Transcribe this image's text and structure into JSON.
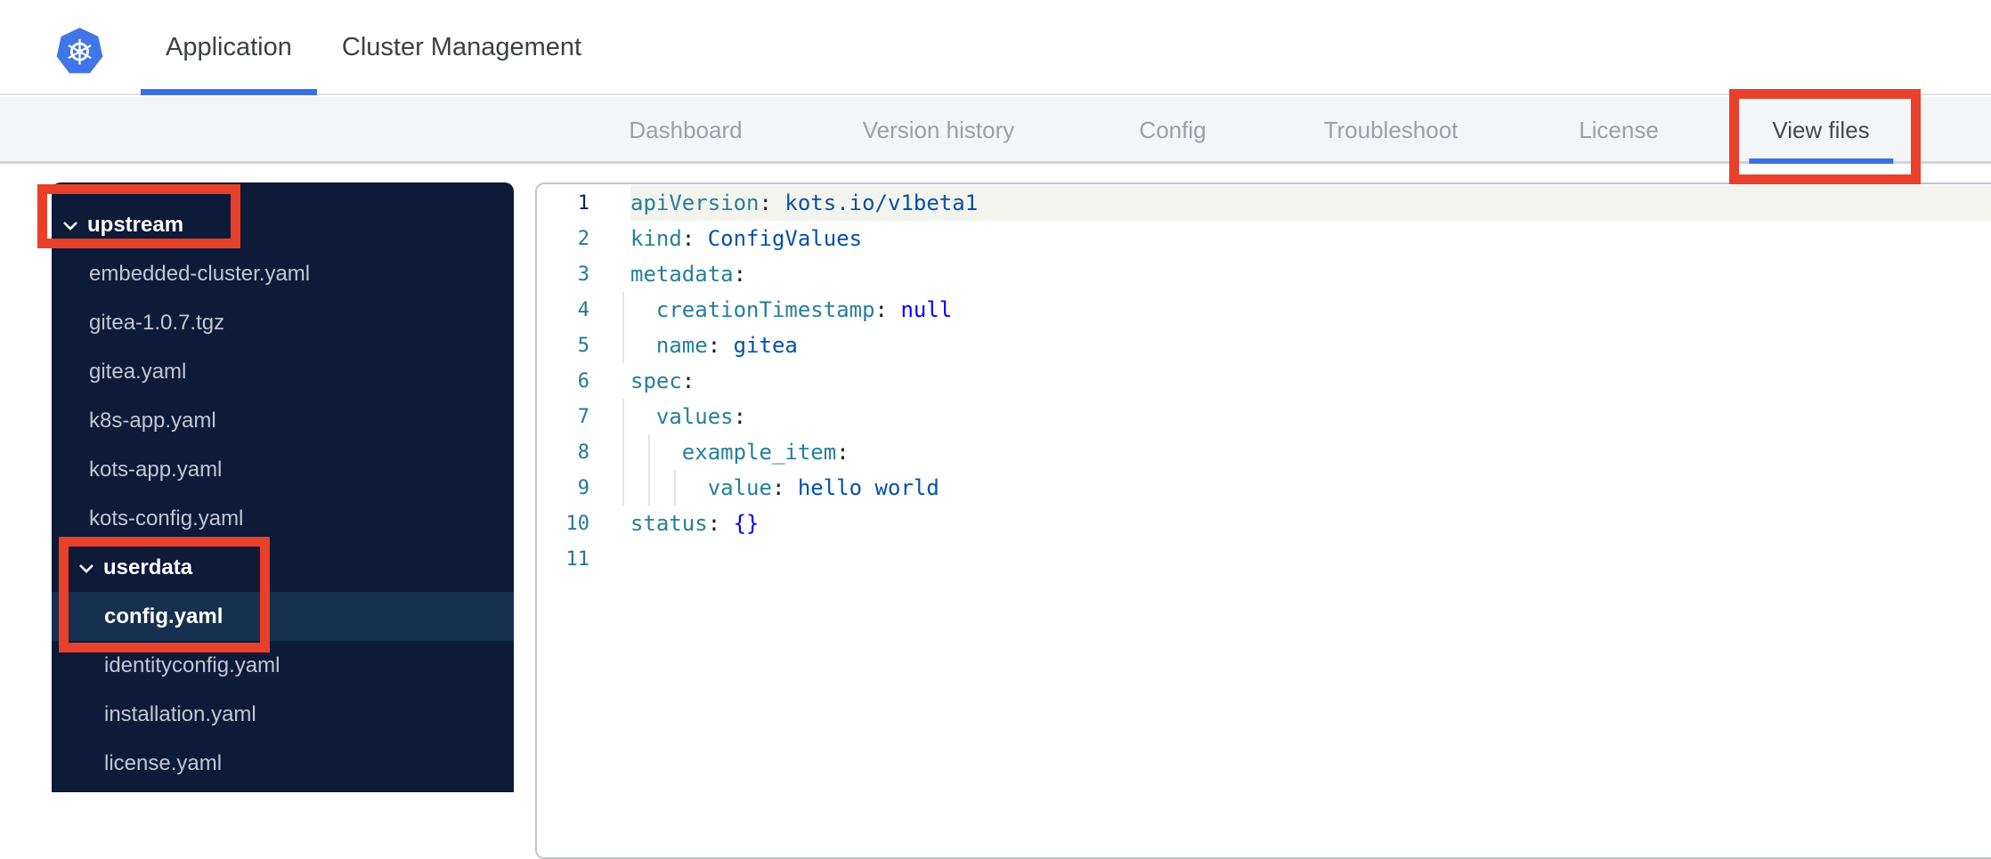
{
  "topbar": {
    "logo": "kubernetes-logo",
    "tabs": [
      {
        "label": "Application",
        "active": true
      },
      {
        "label": "Cluster Management",
        "active": false
      }
    ]
  },
  "subnav": {
    "items": [
      {
        "label": "Dashboard",
        "active": false
      },
      {
        "label": "Version history",
        "active": false
      },
      {
        "label": "Config",
        "active": false
      },
      {
        "label": "Troubleshoot",
        "active": false
      },
      {
        "label": "License",
        "active": false
      },
      {
        "label": "View files",
        "active": true,
        "annotated": true
      }
    ]
  },
  "sidebar": {
    "items": [
      {
        "label": "upstream",
        "type": "folder",
        "expanded": true,
        "level": 0,
        "annotated": true
      },
      {
        "label": "embedded-cluster.yaml",
        "type": "file",
        "level": 1
      },
      {
        "label": "gitea-1.0.7.tgz",
        "type": "file",
        "level": 1
      },
      {
        "label": "gitea.yaml",
        "type": "file",
        "level": 1
      },
      {
        "label": "k8s-app.yaml",
        "type": "file",
        "level": 1
      },
      {
        "label": "kots-app.yaml",
        "type": "file",
        "level": 1
      },
      {
        "label": "kots-config.yaml",
        "type": "file",
        "level": 1
      },
      {
        "label": "userdata",
        "type": "folder",
        "expanded": true,
        "level": 1,
        "annotated": true
      },
      {
        "label": "config.yaml",
        "type": "file",
        "level": 2,
        "selected": true,
        "annotated": true
      },
      {
        "label": "identityconfig.yaml",
        "type": "file",
        "level": 2
      },
      {
        "label": "installation.yaml",
        "type": "file",
        "level": 2
      },
      {
        "label": "license.yaml",
        "type": "file",
        "level": 2
      }
    ]
  },
  "editor": {
    "lines": [
      {
        "num": "1",
        "active": true,
        "segments": [
          {
            "text": "apiVersion",
            "type": "key"
          },
          {
            "text": ":",
            "type": "punct"
          },
          {
            "text": " kots.io/v1beta1",
            "type": "value"
          }
        ]
      },
      {
        "num": "2",
        "segments": [
          {
            "text": "kind",
            "type": "key"
          },
          {
            "text": ":",
            "type": "punct"
          },
          {
            "text": " ConfigValues",
            "type": "value"
          }
        ]
      },
      {
        "num": "3",
        "segments": [
          {
            "text": "metadata",
            "type": "key"
          },
          {
            "text": ":",
            "type": "punct"
          }
        ]
      },
      {
        "num": "4",
        "segments": [
          {
            "text": "  creationTimestamp",
            "type": "key"
          },
          {
            "text": ":",
            "type": "punct"
          },
          {
            "text": " null",
            "type": "keyword"
          }
        ]
      },
      {
        "num": "5",
        "segments": [
          {
            "text": "  name",
            "type": "key"
          },
          {
            "text": ":",
            "type": "punct"
          },
          {
            "text": " gitea",
            "type": "value"
          }
        ]
      },
      {
        "num": "6",
        "segments": [
          {
            "text": "spec",
            "type": "key"
          },
          {
            "text": ":",
            "type": "punct"
          }
        ]
      },
      {
        "num": "7",
        "segments": [
          {
            "text": "  values",
            "type": "key"
          },
          {
            "text": ":",
            "type": "punct"
          }
        ]
      },
      {
        "num": "8",
        "segments": [
          {
            "text": "    example_item",
            "type": "key"
          },
          {
            "text": ":",
            "type": "punct"
          }
        ]
      },
      {
        "num": "9",
        "segments": [
          {
            "text": "      value",
            "type": "key"
          },
          {
            "text": ":",
            "type": "punct"
          },
          {
            "text": " hello world",
            "type": "value"
          }
        ]
      },
      {
        "num": "10",
        "segments": [
          {
            "text": "status",
            "type": "key"
          },
          {
            "text": ":",
            "type": "punct"
          },
          {
            "text": " {}",
            "type": "keyword"
          }
        ]
      },
      {
        "num": "11",
        "segments": []
      }
    ]
  },
  "annotations": [
    {
      "target": "view-files-tab"
    },
    {
      "target": "upstream-folder"
    },
    {
      "target": "userdata-and-config-yaml"
    }
  ],
  "colors": {
    "accent_blue": "#3a6fe3",
    "logo_blue": "#4176e8",
    "annotation_red": "#e8402a",
    "topbar_text": "#3d4046",
    "subnav_text": "#99a0aa",
    "subnav_text_active": "#44484e",
    "sidebar_bg": "#0d1a38",
    "sidebar_text": "#c2c7d2",
    "sidebar_selected_bg": "#16304f",
    "syntax_key": "#267f99",
    "syntax_value": "#0451a5",
    "syntax_keyword": "#0000ff",
    "syntax_punct": "#1f1f1f",
    "line_number": "#237893",
    "line_number_active": "#0b216f",
    "current_line_bg": "#f4f4ef",
    "editor_border": "#c2c6cb"
  }
}
